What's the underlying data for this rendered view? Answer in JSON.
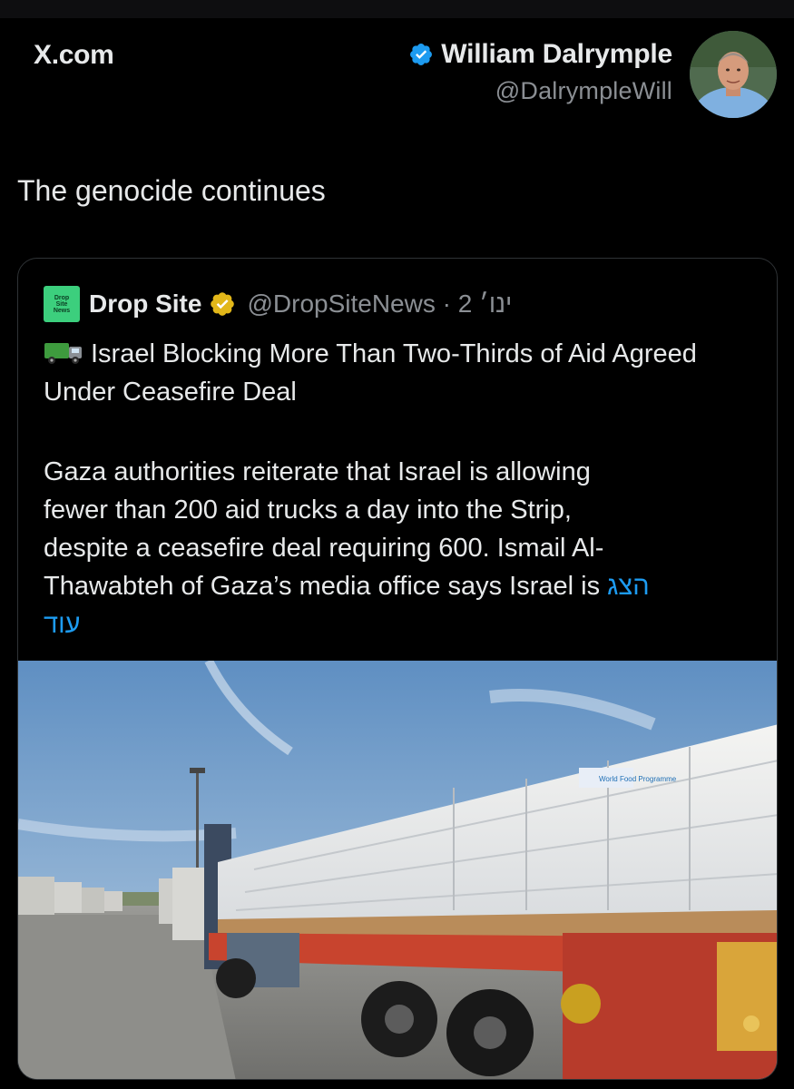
{
  "header": {
    "site": "X.com",
    "author_name": "William Dalrymple",
    "author_handle": "@DalrympleWill"
  },
  "tweet": {
    "text": "The genocide continues"
  },
  "quote": {
    "name": "Drop Site",
    "handle_meta": "@DropSiteNews · ינו׳ 2",
    "logo_text": [
      "Drop",
      "Site",
      "News"
    ],
    "headline": "Israel Blocking More Than Two-Thirds of Aid Agreed Under Ceasefire Deal",
    "body_lines": [
      "Gaza authorities reiterate that Israel is allowing",
      "fewer than 200 aid trucks a day into the Strip,",
      "despite a ceasefire deal requiring 600. Ismail Al-",
      "Thawabteh of Gaza’s media office says Israel is "
    ],
    "show_more_1": "הצג",
    "show_more_2": "עוד",
    "image_labels": [
      "World Food Programme"
    ]
  },
  "colors": {
    "background": "#000000",
    "text": "#e7e9ea",
    "muted": "#8b8f94",
    "link": "#1d9bf0",
    "verified_blue": "#1d9bf0",
    "verified_gold": "#e2b719",
    "logo_green": "#3ccf7d"
  },
  "icons": [
    "verified-blue-icon",
    "verified-gold-icon",
    "truck-emoji-icon",
    "drop-site-logo"
  ]
}
